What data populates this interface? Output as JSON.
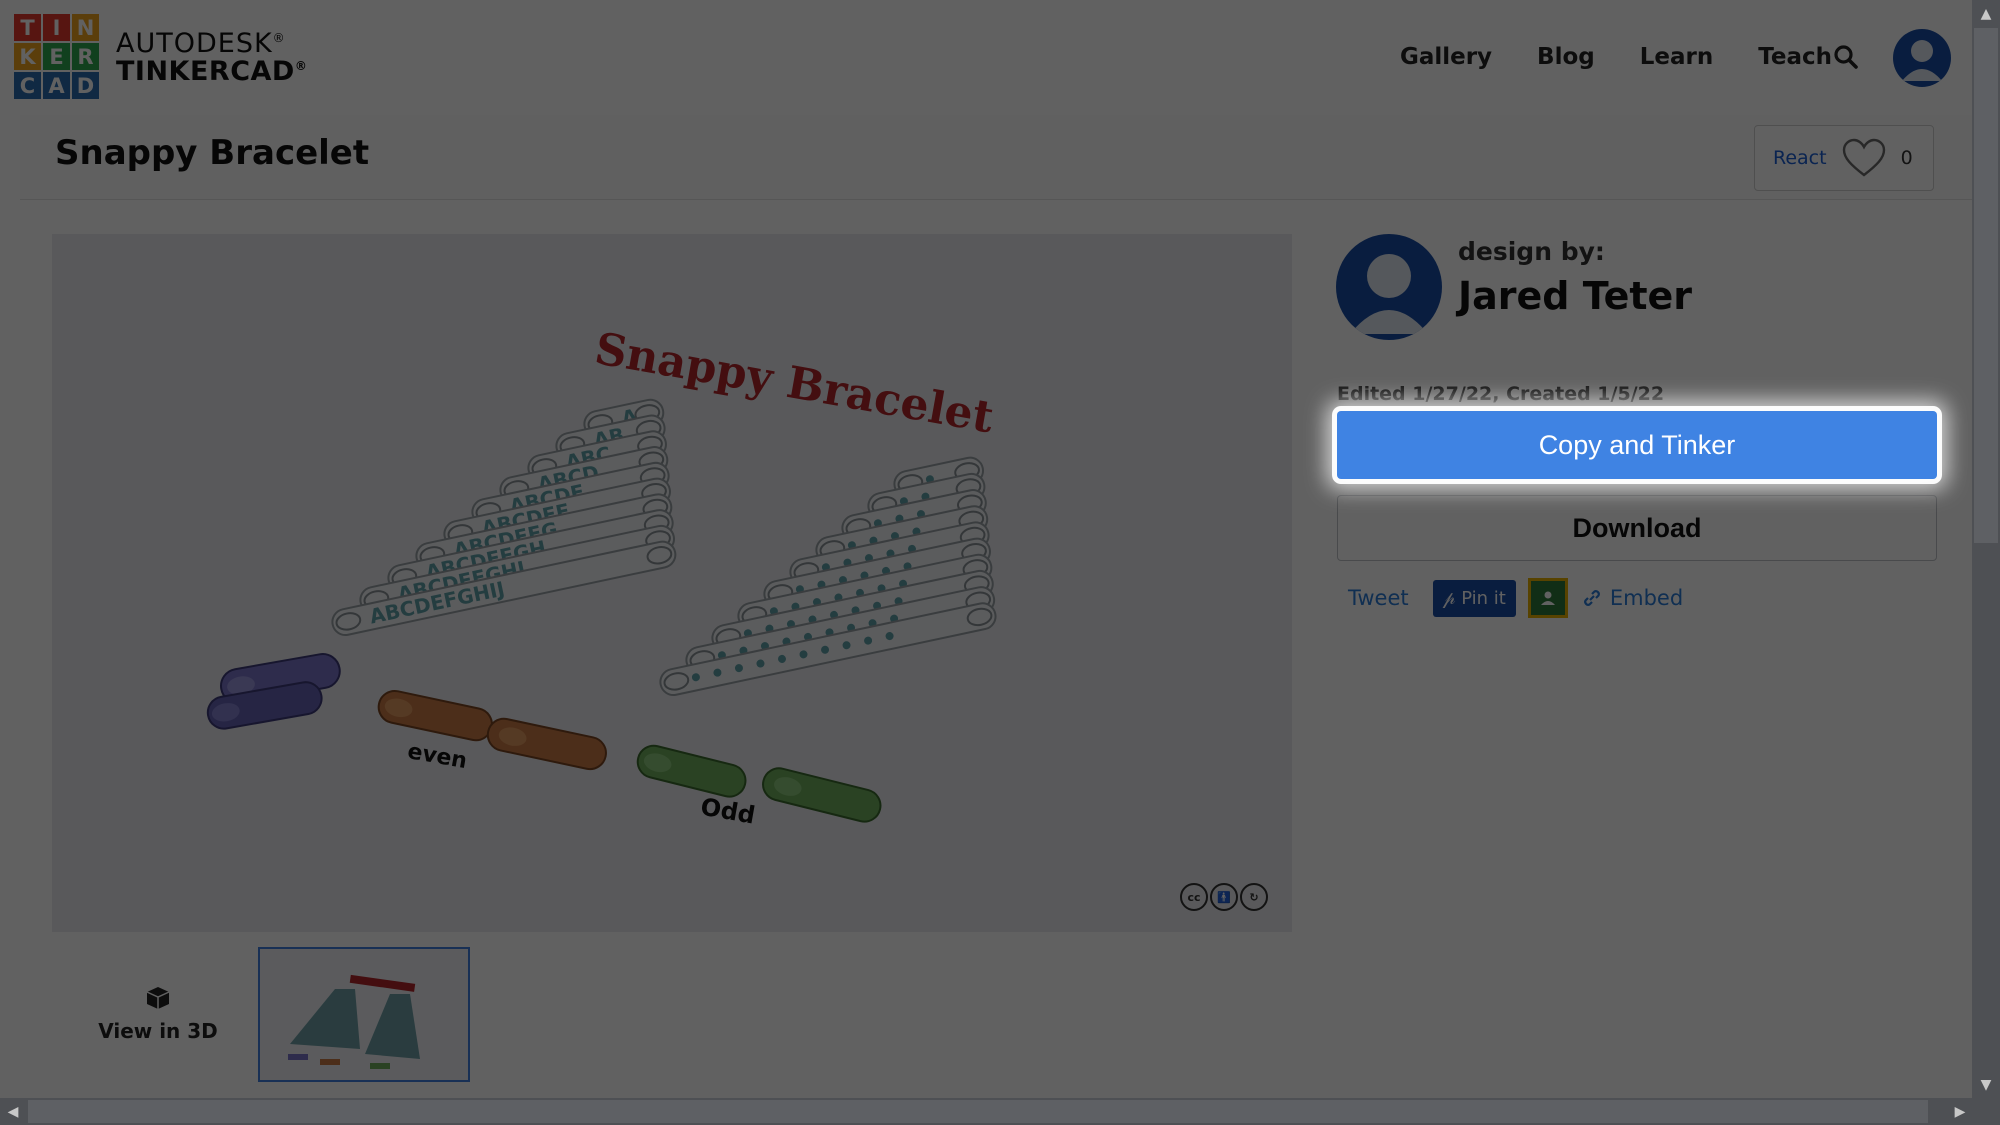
{
  "brand": {
    "logo_letters": [
      "T",
      "I",
      "N",
      "K",
      "E",
      "R",
      "C",
      "A",
      "D"
    ],
    "logo_colors": [
      "#e5392f",
      "#e5392f",
      "#f0a21f",
      "#f0a21f",
      "#2fa84f",
      "#2fa84f",
      "#2b6cb0",
      "#2b6cb0",
      "#2b6cb0"
    ],
    "line1": "AUTODESK",
    "line2": "TINKERCAD",
    "reg_mark": "®"
  },
  "nav": {
    "gallery": "Gallery",
    "blog": "Blog",
    "learn": "Learn",
    "teach": "Teach"
  },
  "design": {
    "title": "Snappy Bracelet",
    "react_label": "React",
    "react_count": "0",
    "render_title": "Snappy Bracelet",
    "render_left_labels": [
      "A",
      "AB",
      "ABC",
      "ABCD",
      "ABCDE",
      "ABCDEF",
      "ABCDEFG",
      "ABCDEFGH",
      "ABCDEFGHI",
      "ABCDEFGHIJ"
    ],
    "render_word_even": "even",
    "render_word_odd": "Odd"
  },
  "gallery": {
    "view3d_label": "View in 3D"
  },
  "designer": {
    "design_by": "design by:",
    "name": "Jared Teter",
    "edited": "Edited 1/27/22, Created 1/5/22"
  },
  "actions": {
    "copy": "Copy and Tinker",
    "download": "Download",
    "tweet": "Tweet",
    "pin": "Pin it",
    "embed": "Embed"
  },
  "license": {
    "cc": "cc"
  },
  "colors": {
    "accent": "#3f83e3",
    "link": "#2b7bd8",
    "dark_blue": "#1a4ea6"
  }
}
